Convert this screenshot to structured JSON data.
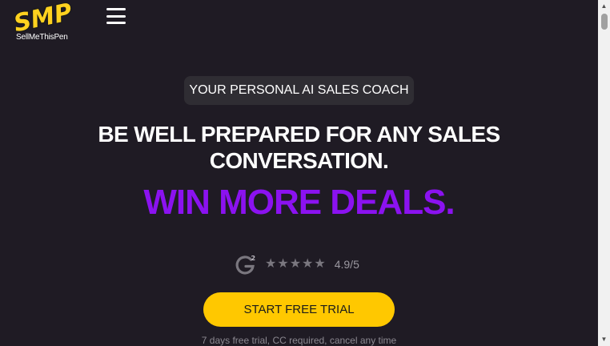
{
  "brand": {
    "logo_text": "SMP",
    "caption": "SellMeThisPen",
    "logo_color": "#ffd21f"
  },
  "header": {
    "menu_icon": "hamburger-menu-icon"
  },
  "hero": {
    "badge": "YOUR PERSONAL AI SALES COACH",
    "headline_line1": "BE WELL PREPARED FOR ANY SALES",
    "headline_line2": "CONVERSATION.",
    "subheadline": "WIN MORE DEALS.",
    "subheadline_color": "#8b12f0"
  },
  "rating": {
    "g2_badge_text": "2",
    "stars_icon": "star-icon",
    "star_count": 5,
    "score": "4.9/5"
  },
  "cta": {
    "label": "START FREE TRIAL",
    "color": "#ffc800",
    "note": "7 days free trial, CC required, cancel any time"
  },
  "colors": {
    "background": "#1f1b24",
    "badge_background": "#2f2d33"
  }
}
